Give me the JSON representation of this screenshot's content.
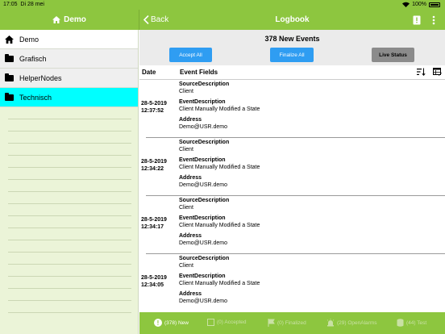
{
  "status_bar": {
    "time": "17:05",
    "date": "Di 28 mei",
    "battery": "100%"
  },
  "nav": {
    "master_title": "Demo",
    "back_label": "Back",
    "title": "Logbook"
  },
  "sidebar": {
    "items": [
      {
        "label": "Demo",
        "icon": "home-icon"
      },
      {
        "label": "Grafisch",
        "icon": "folder-icon"
      },
      {
        "label": "HelperNodes",
        "icon": "folder-icon"
      },
      {
        "label": "Technisch",
        "icon": "folder-icon"
      }
    ]
  },
  "summary": {
    "new_events": "378 New Events",
    "accept_all": "Accept All",
    "finalize_all": "Finalize All",
    "live_status": "Live Status"
  },
  "table": {
    "col_date": "Date",
    "col_fields": "Event Fields",
    "events": [
      {
        "date": "28-5-2019",
        "time": "12:37:52",
        "source_label": "SourceDescription",
        "source": "Client",
        "event_label": "EventDescription",
        "event": "Client Manually Modified a State",
        "address_label": "Address",
        "address": "Demo@USR.demo"
      },
      {
        "date": "28-5-2019",
        "time": "12:34:22",
        "source_label": "SourceDescription",
        "source": "Client",
        "event_label": "EventDescription",
        "event": "Client Manually Modified a State",
        "address_label": "Address",
        "address": "Demo@USR.demo"
      },
      {
        "date": "28-5-2019",
        "time": "12:34:17",
        "source_label": "SourceDescription",
        "source": "Client",
        "event_label": "EventDescription",
        "event": "Client Manually Modified a State",
        "address_label": "Address",
        "address": "Demo@USR.demo"
      },
      {
        "date": "28-5-2019",
        "time": "12:34:05",
        "source_label": "SourceDescription",
        "source": "Client",
        "event_label": "EventDescription",
        "event": "Client Manually Modified a State",
        "address_label": "Address",
        "address": "Demo@USR.demo"
      }
    ]
  },
  "tabs": [
    {
      "label": "(378) New",
      "icon": "alert-icon"
    },
    {
      "label": "(0) Accepted",
      "icon": "checkbox-icon"
    },
    {
      "label": "(0) Finalized",
      "icon": "flag-icon"
    },
    {
      "label": "(29) OpenAlarms",
      "icon": "alarm-icon"
    },
    {
      "label": "(44) Test",
      "icon": "database-icon"
    }
  ],
  "colors": {
    "brand_green": "#8dc63f",
    "accent_blue": "#2f9df2",
    "selected_cyan": "#00ffff",
    "sidebar_bg": "#ebf4d8"
  }
}
